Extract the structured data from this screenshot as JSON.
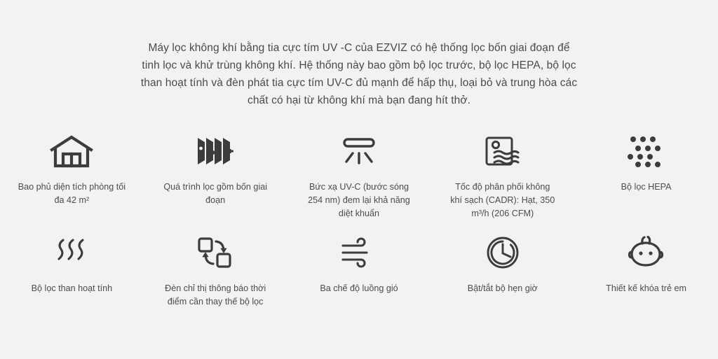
{
  "intro": {
    "paragraph": "Máy lọc không khí bằng tia cực tím UV -C của EZVIZ có hệ thống lọc bốn giai đoạn để tinh lọc và khử trùng không khí. Hệ thống này bao gồm bộ lọc trước, bộ lọc HEPA, bộ lọc than hoạt tính và đèn phát tia cực tím UV-C đủ mạnh để hấp thụ, loại bỏ và trung hòa các chất có hại từ không khí mà bạn đang hít thở."
  },
  "colors": {
    "background": "#f2f2f2",
    "icon": "#3c3c3c",
    "text": "#4a4a4a"
  },
  "features": {
    "row1": [
      {
        "icon": "house-icon",
        "label": "Bao phủ diện tích phòng tối đa 42 m²"
      },
      {
        "icon": "filter-layers-icon",
        "label": "Quá trình lọc gồm bốn giai đoạn"
      },
      {
        "icon": "uv-lamp-icon",
        "label": "Bức xạ UV-C (bước sóng 254 nm) đem lại khả năng diệt khuẩn"
      },
      {
        "icon": "airflow-panel-icon",
        "label": "Tốc độ phân phối không khí sạch (CADR): Hạt, 350 m³/h (206 CFM)"
      },
      {
        "icon": "hepa-dots-icon",
        "label": "Bộ lọc HEPA"
      }
    ],
    "row2": [
      {
        "icon": "carbon-waves-icon",
        "label": "Bộ lọc than hoạt tính"
      },
      {
        "icon": "filter-replace-icon",
        "label": "Đèn chỉ thị thông báo thời điểm cần thay thế bộ lọc"
      },
      {
        "icon": "wind-modes-icon",
        "label": "Ba chế độ luồng gió"
      },
      {
        "icon": "timer-clock-icon",
        "label": "Bật/tắt bộ hẹn giờ"
      },
      {
        "icon": "child-lock-icon",
        "label": "Thiết kế khóa trẻ em"
      }
    ]
  }
}
